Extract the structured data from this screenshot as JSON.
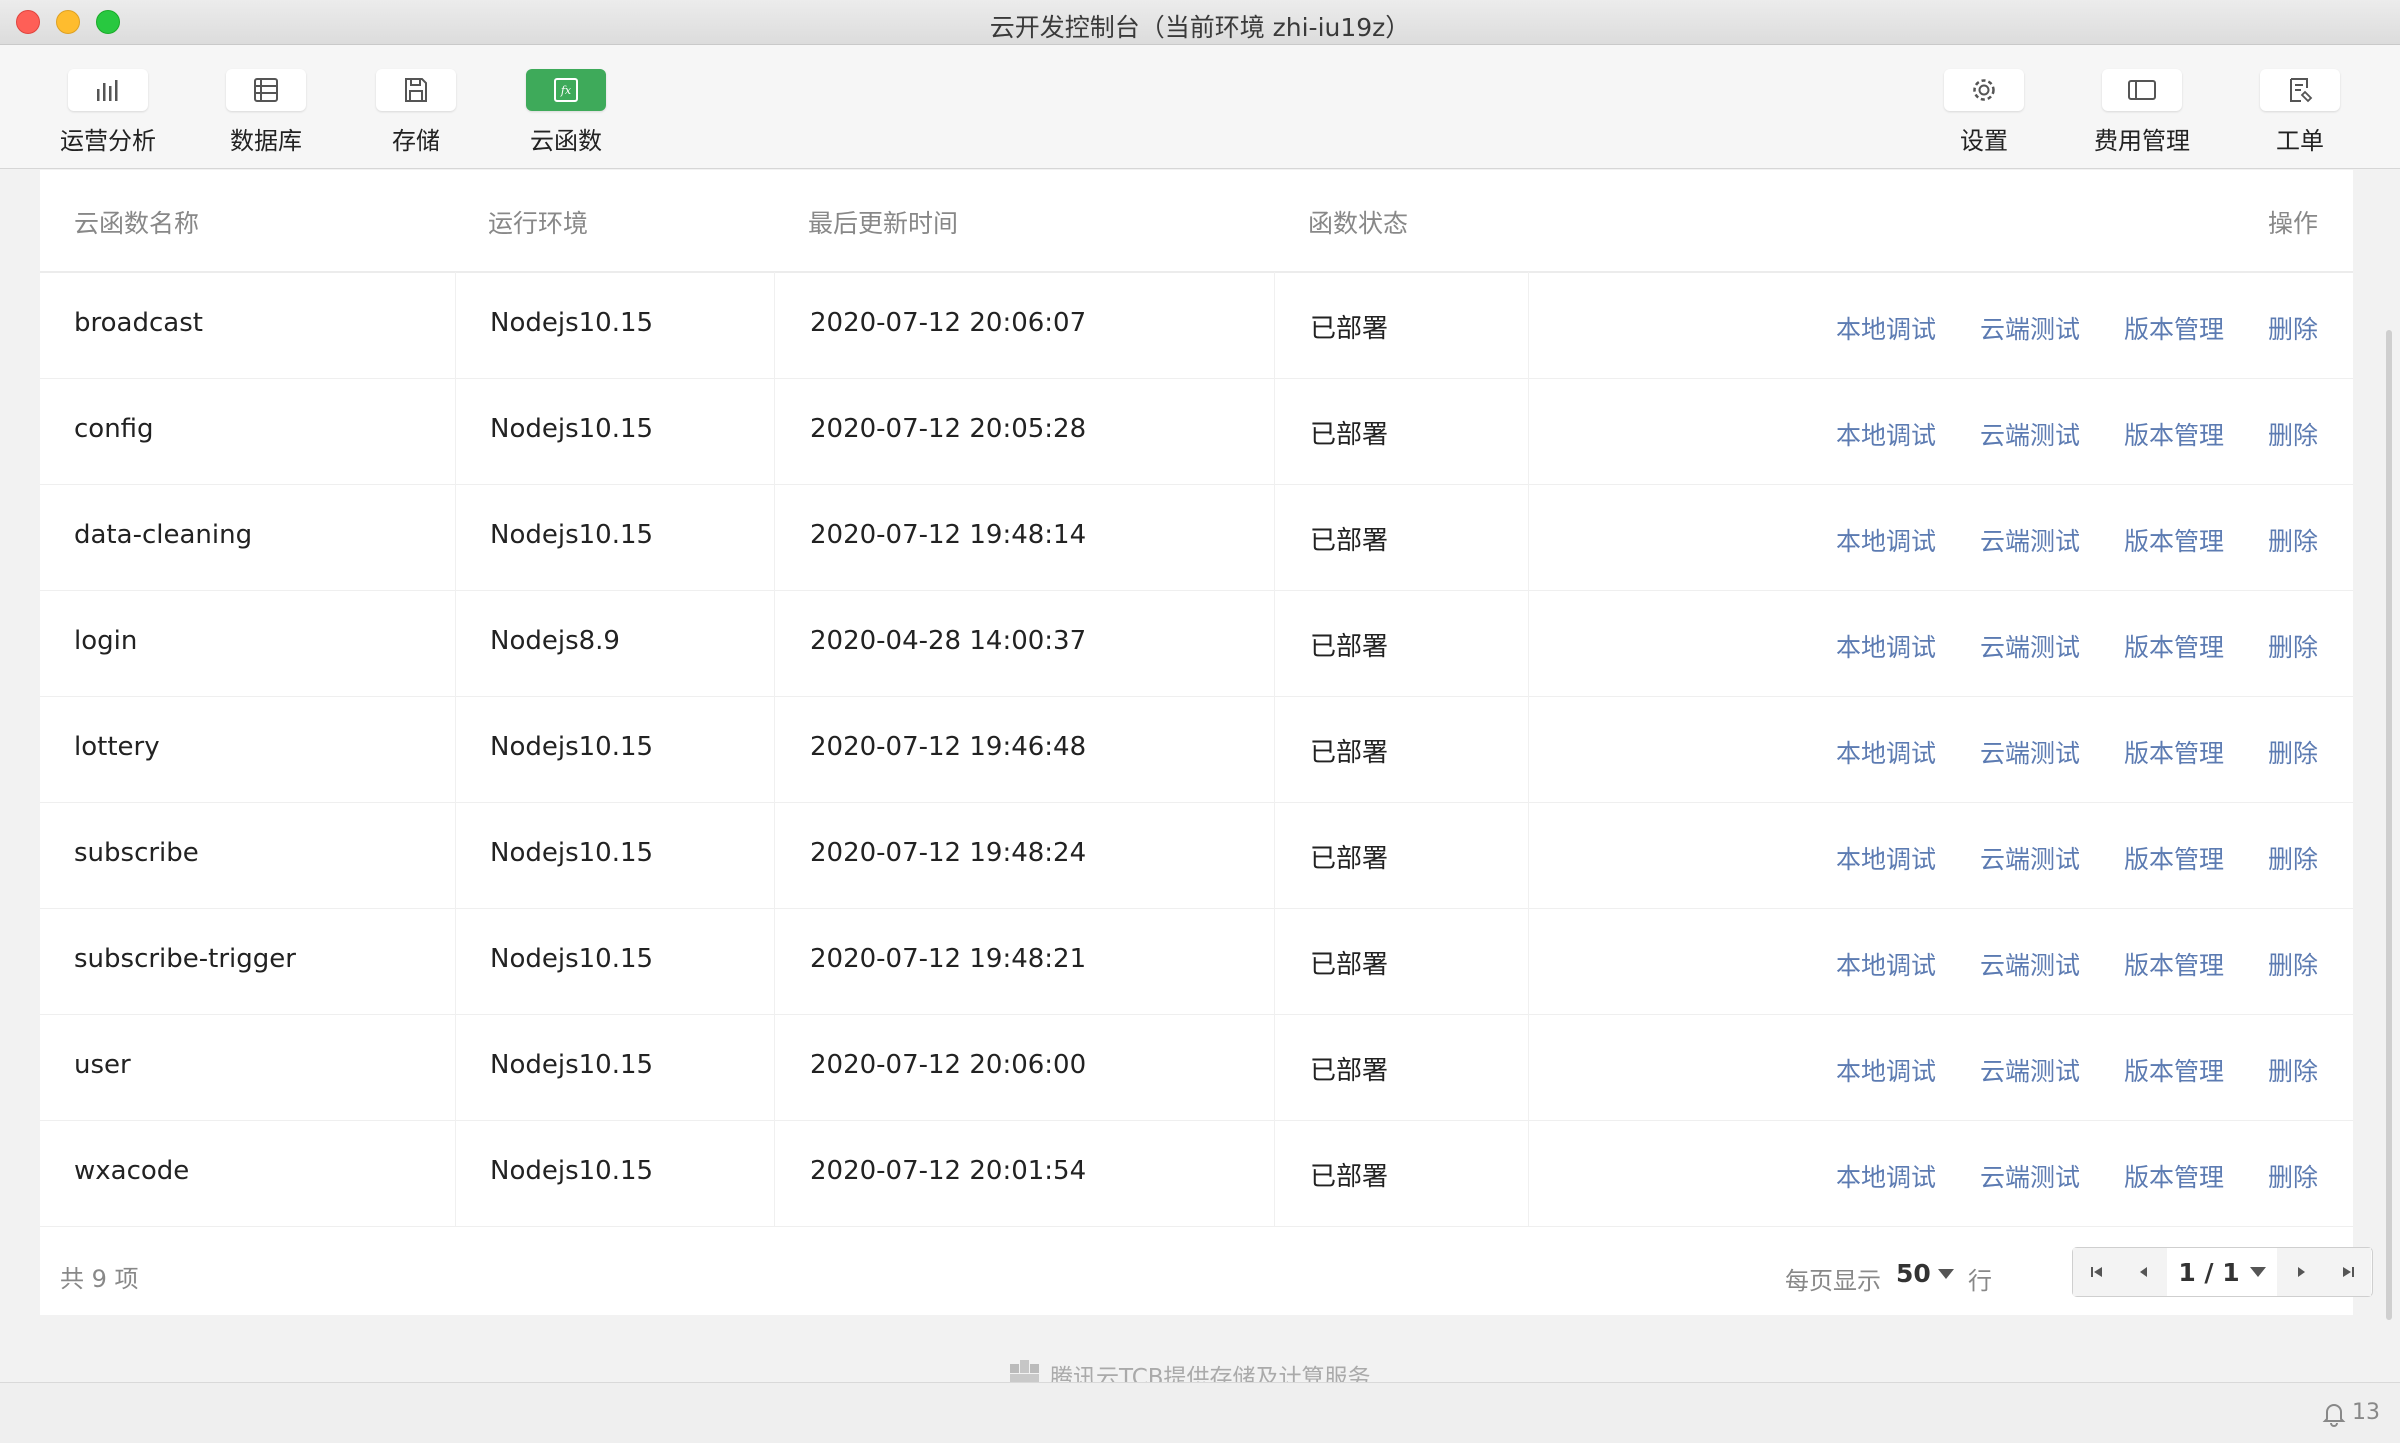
{
  "window": {
    "title": "云开发控制台（当前环境 zhi-iu19z）"
  },
  "toolbar": {
    "left": [
      {
        "label": "运营分析",
        "icon": "bar-chart-icon",
        "active": false
      },
      {
        "label": "数据库",
        "icon": "database-icon",
        "active": false
      },
      {
        "label": "存储",
        "icon": "save-icon",
        "active": false
      },
      {
        "label": "云函数",
        "icon": "function-icon",
        "active": true
      }
    ],
    "right": [
      {
        "label": "设置",
        "icon": "gear-icon"
      },
      {
        "label": "费用管理",
        "icon": "billing-icon"
      },
      {
        "label": "工单",
        "icon": "ticket-icon"
      }
    ],
    "accent_color": "#3eaa5a"
  },
  "table": {
    "columns": {
      "name": "云函数名称",
      "runtime": "运行环境",
      "updated": "最后更新时间",
      "status": "函数状态",
      "actions": "操作"
    },
    "actions": {
      "local_debug": "本地调试",
      "cloud_test": "云端测试",
      "versions": "版本管理",
      "delete": "删除"
    },
    "rows": [
      {
        "name": "broadcast",
        "runtime": "Nodejs10.15",
        "updated": "2020-07-12 20:06:07",
        "status": "已部署"
      },
      {
        "name": "config",
        "runtime": "Nodejs10.15",
        "updated": "2020-07-12 20:05:28",
        "status": "已部署"
      },
      {
        "name": "data-cleaning",
        "runtime": "Nodejs10.15",
        "updated": "2020-07-12 19:48:14",
        "status": "已部署"
      },
      {
        "name": "login",
        "runtime": "Nodejs8.9",
        "updated": "2020-04-28 14:00:37",
        "status": "已部署"
      },
      {
        "name": "lottery",
        "runtime": "Nodejs10.15",
        "updated": "2020-07-12 19:46:48",
        "status": "已部署"
      },
      {
        "name": "subscribe",
        "runtime": "Nodejs10.15",
        "updated": "2020-07-12 19:48:24",
        "status": "已部署"
      },
      {
        "name": "subscribe-trigger",
        "runtime": "Nodejs10.15",
        "updated": "2020-07-12 19:48:21",
        "status": "已部署"
      },
      {
        "name": "user",
        "runtime": "Nodejs10.15",
        "updated": "2020-07-12 20:06:00",
        "status": "已部署"
      },
      {
        "name": "wxacode",
        "runtime": "Nodejs10.15",
        "updated": "2020-07-12 20:01:54",
        "status": "已部署"
      }
    ],
    "link_color": "#5c7bb2"
  },
  "footer": {
    "total": "共 9 项",
    "per_page_label": "每页显示",
    "per_page_value": "50",
    "per_page_unit": "行",
    "page": "1 / 1"
  },
  "powered_by": "腾讯云TCB提供存储及计算服务",
  "status_bar": {
    "notifications": "13"
  }
}
